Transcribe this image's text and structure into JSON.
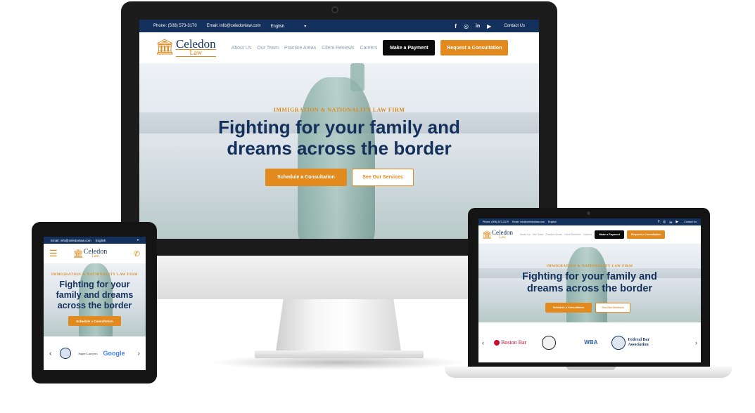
{
  "site": {
    "brand_name": "Celedon",
    "brand_sub": "Law",
    "phone": "Phone: (508) 573-3170",
    "email": "Email: info@celedonlaw.com",
    "language": "English",
    "contact_link": "Contact Us",
    "nav": [
      "About Us",
      "Our Team",
      "Practice Areas",
      "Client Reviews",
      "Careers"
    ],
    "make_payment": "Make a Payment",
    "request_consultation": "Request a Consultation",
    "eyebrow": "IMMIGRATION & NATIONALITY LAW FIRM",
    "headline_line1": "Fighting for your family and",
    "headline_line2": "dreams across the border",
    "schedule_btn": "Schedule a Consultation",
    "services_btn": "See Our Services",
    "social_icons": [
      "facebook-icon",
      "instagram-icon",
      "linkedin-icon",
      "youtube-icon"
    ]
  },
  "tablet": {
    "email": "Email: info@celedonlaw.com",
    "language": "English",
    "headline_line1": "Fighting for your",
    "headline_line2": "family and dreams",
    "headline_line3": "across the border",
    "logos": [
      "Super Lawyers",
      "Google"
    ]
  },
  "laptop": {
    "logos": [
      "Boston Bar",
      "WBA",
      "Federal Bar Association"
    ]
  },
  "colors": {
    "navy": "#14305c",
    "orange": "#e28a1e",
    "black": "#0b0b0b"
  }
}
